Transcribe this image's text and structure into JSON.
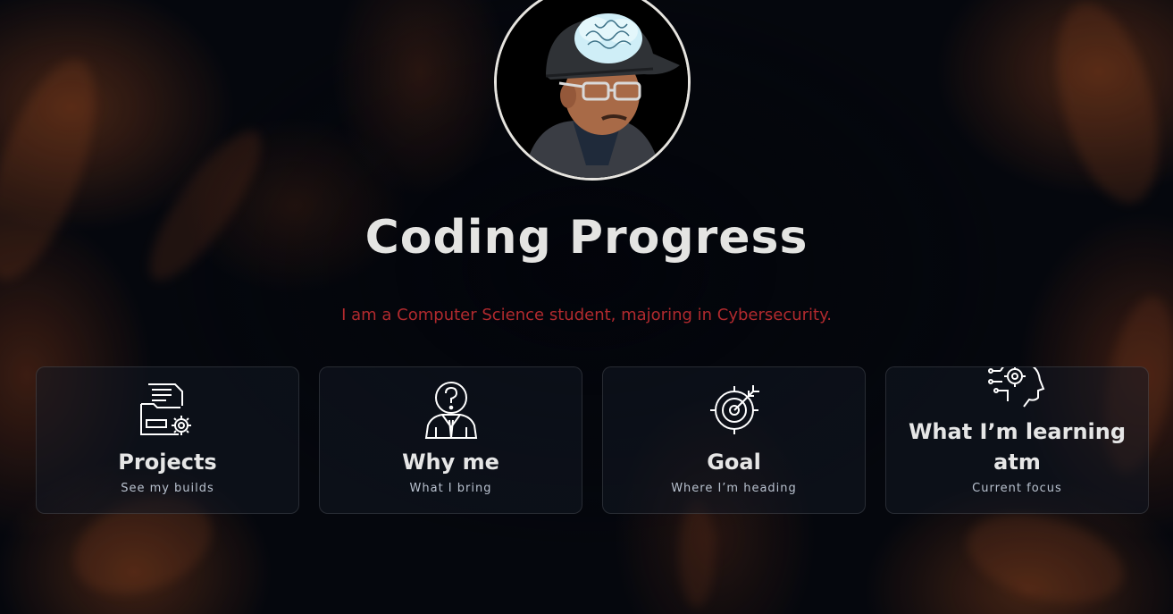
{
  "hero": {
    "title": "Coding Progress",
    "subtitle": "I am a Computer Science student, majoring in Cybersecurity.",
    "avatar_icon": "avatar-with-brain-cap"
  },
  "cards": [
    {
      "title": "Projects",
      "subtitle": "See my builds",
      "icon": "folder-gear-icon"
    },
    {
      "title": "Why me",
      "subtitle": "What I bring",
      "icon": "person-question-icon"
    },
    {
      "title": "Goal",
      "subtitle": "Where I’m heading",
      "icon": "target-arrow-icon"
    },
    {
      "title": "What I’m learning atm",
      "subtitle": "Current focus",
      "icon": "head-gear-icon"
    }
  ],
  "colors": {
    "title": "#e4e4e2",
    "subtitle": "#b12a2e",
    "background": "#05070d",
    "card_border": "rgba(255,255,255,0.12)"
  }
}
